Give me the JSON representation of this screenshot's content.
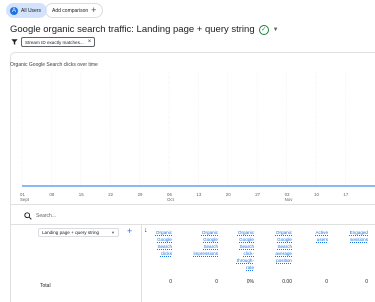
{
  "toolbar": {
    "all_users_label": "All Users",
    "add_comparison_label": "Add comparison"
  },
  "report": {
    "title": "Google organic search traffic: Landing page + query string",
    "filter_label": "Stream ID exactly matches..."
  },
  "chart": {
    "title": "Organic Google Search clicks over time",
    "x_ticks": [
      {
        "day": "01",
        "month": "Sept"
      },
      {
        "day": "08",
        "month": ""
      },
      {
        "day": "15",
        "month": ""
      },
      {
        "day": "22",
        "month": ""
      },
      {
        "day": "29",
        "month": ""
      },
      {
        "day": "06",
        "month": "Oct"
      },
      {
        "day": "13",
        "month": ""
      },
      {
        "day": "20",
        "month": ""
      },
      {
        "day": "27",
        "month": ""
      },
      {
        "day": "03",
        "month": "Nov"
      },
      {
        "day": "10",
        "month": ""
      },
      {
        "day": "17",
        "month": ""
      }
    ],
    "series_color": "#1a73e8"
  },
  "chart_data": {
    "type": "line",
    "title": "Organic Google Search clicks over time",
    "x": [
      "01 Sept",
      "08",
      "15",
      "22",
      "29",
      "06 Oct",
      "13",
      "20",
      "27",
      "03 Nov",
      "10",
      "17"
    ],
    "series": [
      {
        "values": [
          0,
          0,
          0,
          0,
          0,
          0,
          0,
          0,
          0,
          0,
          0,
          0
        ]
      }
    ]
  },
  "search": {
    "placeholder": "Search..."
  },
  "table": {
    "dimension_select": "Landing page + query string",
    "columns": [
      {
        "id": "clicks",
        "label": "Organic Google Search clicks",
        "lines": [
          "Organic",
          "Google",
          "Search",
          "clicks"
        ]
      },
      {
        "id": "impressions",
        "label": "Organic Google Search impressions",
        "lines": [
          "Organic",
          "Google",
          "Search",
          "impressions"
        ]
      },
      {
        "id": "ctr",
        "label": "Organic Google Search click-through-rate",
        "lines": [
          "Organic",
          "Google",
          "Search",
          "click-",
          "through-",
          "rate"
        ]
      },
      {
        "id": "position",
        "label": "Organic Google Search average position",
        "lines": [
          "Organic",
          "Google",
          "Search",
          "average",
          "position"
        ]
      },
      {
        "id": "active_users",
        "label": "Active users",
        "lines": [
          "Active",
          "users"
        ]
      },
      {
        "id": "engaged_sessions",
        "label": "Engaged sessions",
        "lines": [
          "Engaged",
          "sessions"
        ]
      }
    ],
    "total_row": {
      "label": "Total",
      "values": [
        "0",
        "0",
        "0%",
        "0.00",
        "0",
        "0"
      ]
    }
  }
}
